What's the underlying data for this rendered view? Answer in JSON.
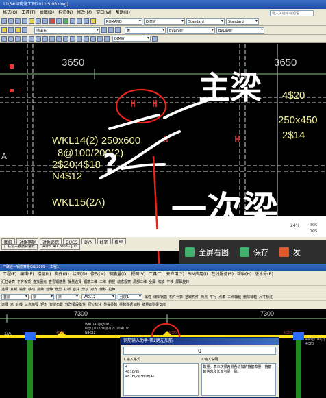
{
  "top_window": {
    "title": "11\\5#结构施工图2012.5.08.dwg]",
    "menu": [
      "格式(O)",
      "工具(T)",
      "绘图(D)",
      "标注(N)",
      "修改(M)",
      "窗口(W)",
      "帮助(H)"
    ],
    "search_placeholder": "键入关键字或短语",
    "toolbar1": {
      "style_combo": "ROMAND",
      "dim_combo": "DIMW",
      "standard_combo": "Standard",
      "standard2_combo": "Standard"
    },
    "toolbar2": {
      "layer_combo": "墙填充",
      "color_combo": "黄",
      "linetype_combo": "ByLayer",
      "lineweight_combo": "ByLayer"
    },
    "toolbar3": {
      "dim_combo": "DIMW"
    }
  },
  "drawing": {
    "dim_left": "3650",
    "dim_right": "3650",
    "beam_label_1": "WKL14(2) 250x600",
    "beam_label_2": "8@100/200(2)",
    "beam_label_3": "2$20;4$18",
    "beam_label_4": "N4$12",
    "beam_label_5": "WKL15(2A)",
    "right_label_1": "4$20",
    "right_label_2": "250x450",
    "right_label_3": "2$14",
    "annotation_main": "主梁",
    "annotation_secondary": "一次梁",
    "annotation_mark": "?",
    "grid_letter": "A"
  },
  "taskbar": {
    "items": [
      "图纸",
      "对象捕捉",
      "对象追踪",
      "DUCS",
      "DYN",
      "线宽",
      "模型"
    ],
    "task_1": "广联达—钢筋算量软",
    "task_2": "AutoCAD 2008 - [D:\\",
    "tray_1": "24%",
    "tray_2": "0K/S",
    "tray_3": "0K/S"
  },
  "viewer": {
    "fullscreen_label": "全屏看图",
    "save_label": "保存",
    "send_label": "发",
    "colors": {
      "fullscreen": "#3db36b",
      "save": "#3db36b",
      "send": "#e05a2b"
    }
  },
  "bottom_window": {
    "title": "广联达—钢筋算量GGJ2009 - [工程1]",
    "menu": [
      "工程(F)",
      "编辑(E)",
      "楼层(L)",
      "构件(N)",
      "绘图(D)",
      "修改(M)",
      "钢筋量(Q)",
      "视图(V)",
      "工具(T)",
      "云应用(Y)",
      "BIM应用(I)",
      "在线服务(S)",
      "帮助(H)",
      "版本号(B)"
    ],
    "row1": [
      "汇总计算",
      "平齐板顶",
      "查找图元",
      "查看钢筋量",
      "批量选择",
      "钢筋三维",
      "二维",
      "俯视",
      "动态观察",
      "局部三维",
      "全屏",
      "缩放",
      "平移",
      "屏幕旋转"
    ],
    "row2": [
      "选择",
      "复制",
      "镜像",
      "移动",
      "旋转",
      "延伸",
      "修剪",
      "打断",
      "合并",
      "分割",
      "对齐",
      "偏移",
      "拉伸"
    ],
    "row3": {
      "floor_combo": "首层",
      "type_combo": "梁",
      "sub_combo": "梁",
      "name_combo": "WKL12",
      "layer_combo": "分层1",
      "items": [
        "属性",
        "编辑钢筋",
        "构件列表",
        "拾取构件",
        "两点",
        "平行",
        "点角",
        "三点辅轴",
        "删除辅轴",
        "尺寸标注"
      ]
    },
    "row4": [
      "选择",
      "点",
      "直线",
      "三点画弧",
      "矩形",
      "智能布置",
      "修改梁段属性",
      "原位标注",
      "重提梁跨",
      "梁跨数据复制",
      "批量识别梁支座"
    ],
    "drawing": {
      "dim_top": "7300",
      "dim_right": "7300",
      "grid_label": "1/A",
      "beam_text_1": "WKL14 2(0)500",
      "beam_text_2": "8@0(100/200)(2) 2C20;4C18",
      "beam_text_3": "N4C12",
      "mark_left": "4C20",
      "mark_right": "4C20",
      "mark_far": "4C20",
      "mark_far_2": "4A8@100(2)",
      "mark_far_3": "4C20"
    },
    "dialog": {
      "title": "钢筋输入助手-第2跨左加筋",
      "result": "0",
      "panel1_title": "1.输入格式",
      "panel1_lines": [
        "4",
        "4B16(2)",
        "4B16(2)/3B18(4)"
      ],
      "panel2_title": "2.输入说明",
      "panel2_text": "数量。表示次梁两侧各增加的箍筋数量，箍筋的信息和长度与梁一致。"
    }
  }
}
